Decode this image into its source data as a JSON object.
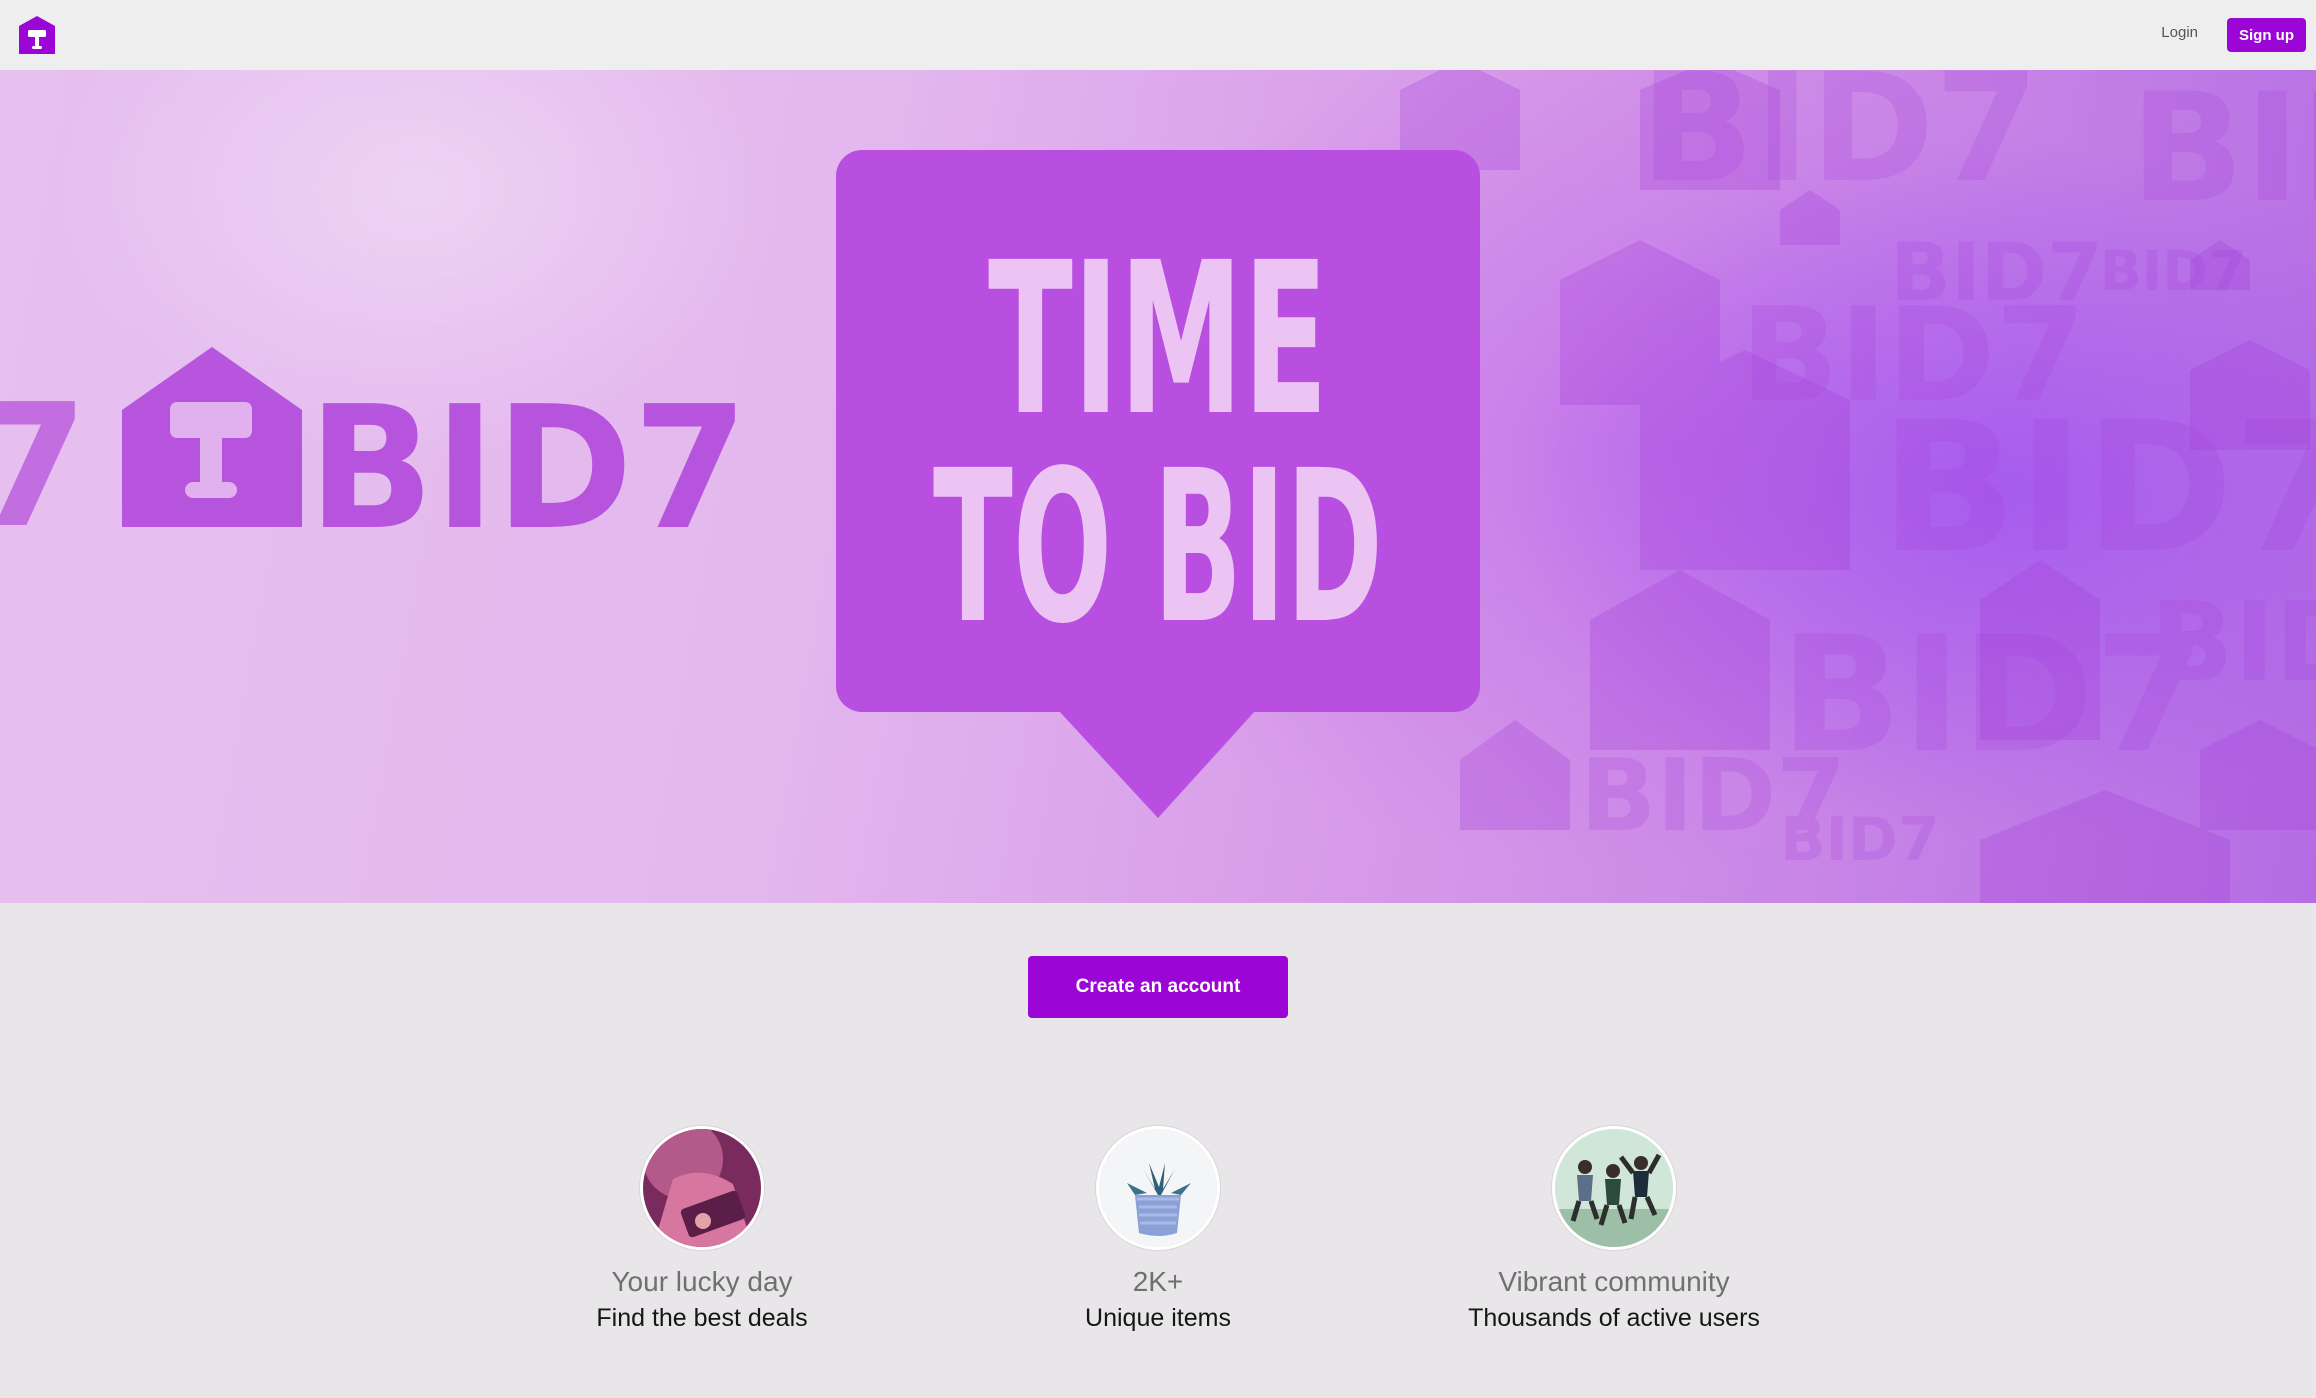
{
  "header": {
    "logo_icon": "bid7-house-gavel-icon",
    "login_label": "Login",
    "signup_label": "Sign up"
  },
  "hero": {
    "brand_wordmark": "BID7",
    "bubble_line1": "TIME",
    "bubble_line2": "TO BID",
    "pattern_text": "BID7"
  },
  "cta": {
    "label": "Create an account"
  },
  "features": [
    {
      "icon": "person-with-laptop-avatar",
      "title": "Your lucky day",
      "subtitle": "Find the best deals"
    },
    {
      "icon": "potted-succulent-avatar",
      "title": "2K+",
      "subtitle": "Unique items"
    },
    {
      "icon": "group-jumping-avatar",
      "title": "Vibrant community",
      "subtitle": "Thousands of active users"
    }
  ],
  "colors": {
    "accent": "#9b06d6",
    "hero_purple": "#b94fe0",
    "background": "#e8e6e8"
  }
}
